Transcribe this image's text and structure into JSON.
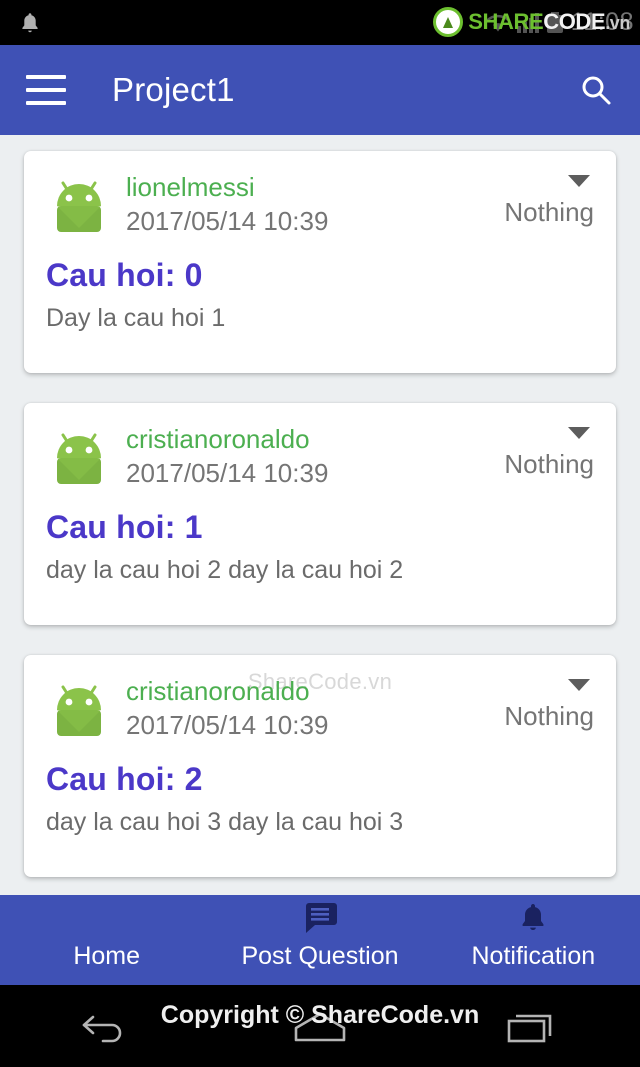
{
  "statusbar": {
    "bell_icon": "bell-icon",
    "clock": "11:08",
    "watermark": {
      "share": "SHARE",
      "code": "CODE",
      "vn": ".vn"
    }
  },
  "appbar": {
    "menu_icon": "hamburger-menu-icon",
    "title": "Project1",
    "search_icon": "search-icon"
  },
  "feed": {
    "cards": [
      {
        "avatar_icon": "android-robot-avatar",
        "username": "lionelmessi",
        "timestamp": "2017/05/14 10:39",
        "spinner_value": "Nothing",
        "caret_icon": "chevron-down-icon",
        "title": "Cau hoi: 0",
        "body": "Day la cau hoi 1",
        "watermark": ""
      },
      {
        "avatar_icon": "android-robot-avatar",
        "username": "cristianoronaldo",
        "timestamp": "2017/05/14 10:39",
        "spinner_value": "Nothing",
        "caret_icon": "chevron-down-icon",
        "title": "Cau hoi: 1",
        "body": "day la cau hoi 2 day la cau hoi 2",
        "watermark": ""
      },
      {
        "avatar_icon": "android-robot-avatar",
        "username": "cristianoronaldo",
        "timestamp": "2017/05/14 10:39",
        "spinner_value": "Nothing",
        "caret_icon": "chevron-down-icon",
        "title": "Cau hoi: 2",
        "body": "day la cau hoi 3 day la cau hoi 3",
        "watermark": "ShareCode.vn"
      }
    ]
  },
  "bottomnav": {
    "items": [
      {
        "label": "Home",
        "icon": "home-icon"
      },
      {
        "label": "Post Question",
        "icon": "message-bubble-icon"
      },
      {
        "label": "Notification",
        "icon": "bell-icon"
      }
    ]
  },
  "sysnav": {
    "back_icon": "back-arrow-icon",
    "home_icon": "home-button-icon",
    "recents_icon": "recent-apps-icon",
    "copyright": "Copyright © ShareCode.vn"
  },
  "colors": {
    "primary": "#3f51b5",
    "accent_title": "#4b38c8",
    "username": "#4caf50",
    "background": "#eceff1",
    "nav_icon": "#1a2260"
  }
}
